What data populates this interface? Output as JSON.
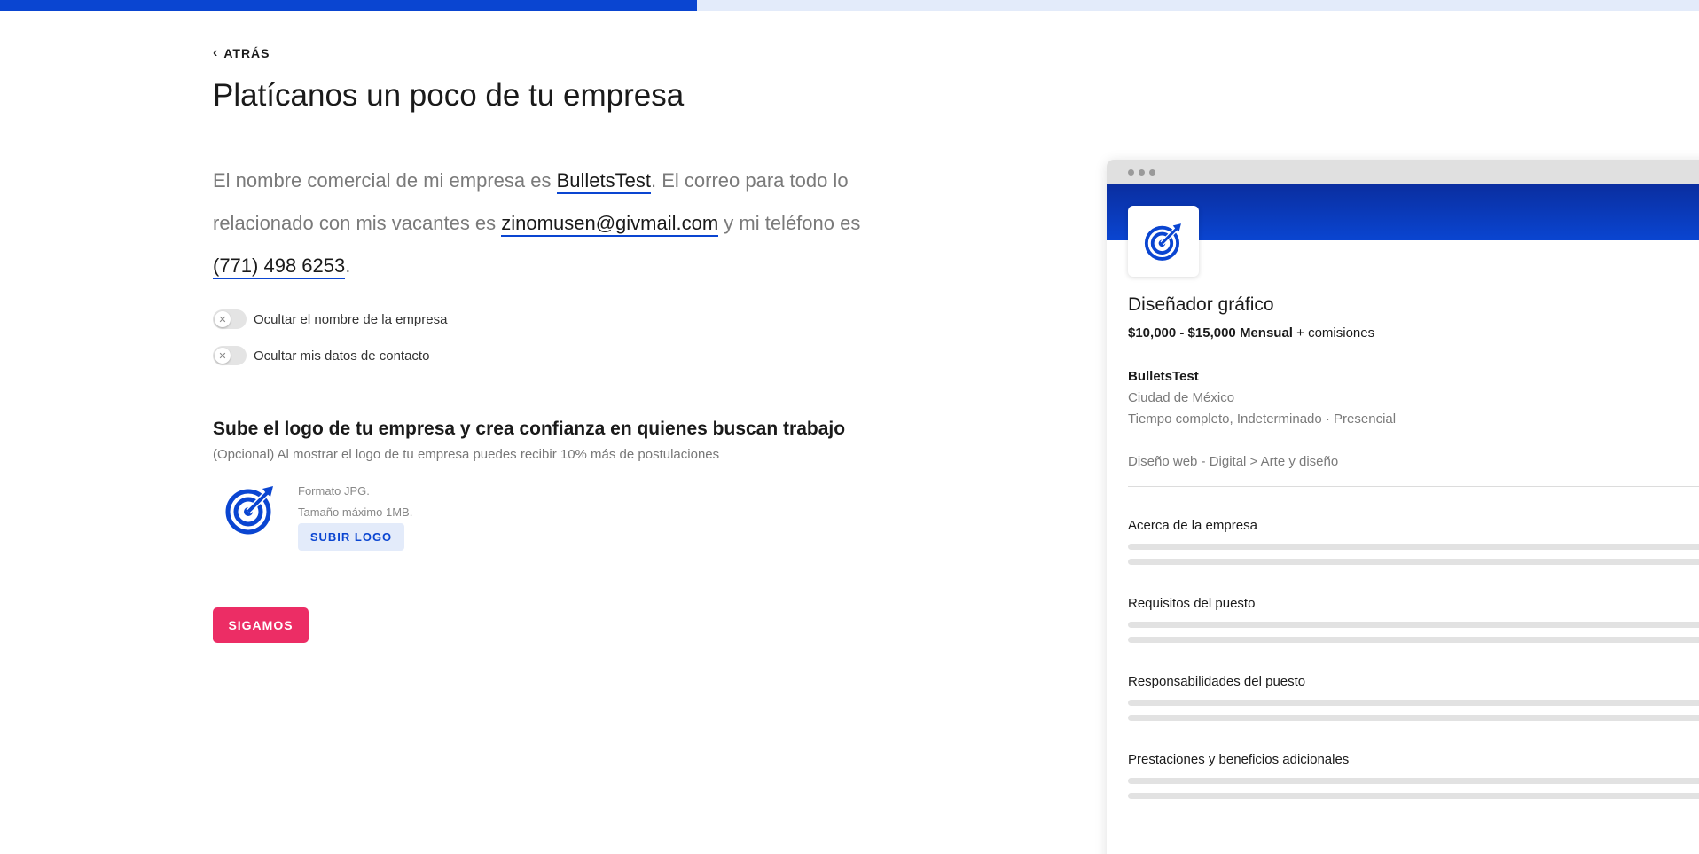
{
  "progress": {
    "fraction": 0.41,
    "fill_color": "#0a45d1",
    "track_color": "#e3ebfa"
  },
  "nav": {
    "back_label": "ATRÁS",
    "back_icon": "chevron-left-icon"
  },
  "page": {
    "title": "Platícanos un poco de tu empresa"
  },
  "madlib": {
    "part1": "El nombre comercial de mi empresa es ",
    "company_name": "BulletsTest",
    "part2": ". El correo para todo lo relacionado con mis vacantes es ",
    "email": "zinomusen@givmail.com",
    "part3": " y mi teléfono es ",
    "phone": "(771) 498 6253",
    "part4": "."
  },
  "toggles": [
    {
      "label": "Ocultar el nombre de la empresa",
      "on": false
    },
    {
      "label": "Ocultar mis datos de contacto",
      "on": false
    }
  ],
  "logo_section": {
    "title": "Sube el logo de tu empresa y crea confianza en quienes buscan trabajo",
    "subtitle": "(Opcional) Al mostrar el logo de tu empresa puedes recibir 10% más de postulaciones",
    "format": "Formato JPG.",
    "max_size": "Tamaño máximo 1MB.",
    "upload_label": "SUBIR LOGO",
    "logo_icon": "target-arrow-icon"
  },
  "continue_label": "SIGAMOS",
  "preview": {
    "job_title": "Diseñador gráfico",
    "salary": "$10,000 - $15,000 Mensual",
    "salary_extra": " + comisiones",
    "company": "BulletsTest",
    "city": "Ciudad de México",
    "job_type": "Tiempo completo, Indeterminado · Presencial",
    "category": "Diseño web - Digital > Arte y diseño",
    "sections": [
      "Acerca de la empresa",
      "Requisitos del puesto",
      "Responsabilidades del puesto",
      "Prestaciones y beneficios adicionales"
    ]
  },
  "colors": {
    "brand_blue": "#0a45d1",
    "accent_pink": "#ec2d65"
  }
}
